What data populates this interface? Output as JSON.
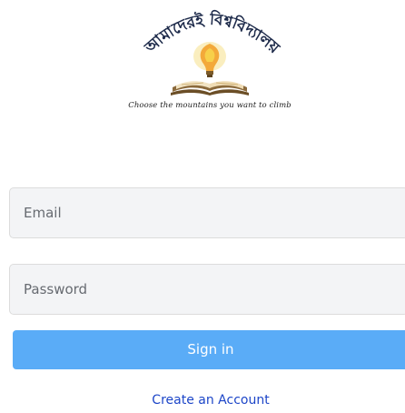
{
  "logo": {
    "wordmark": "আমাদেরই বিশ্ববিদ্যালয়",
    "tagline": "Choose the mountains you want to climb"
  },
  "form": {
    "email_placeholder": "Email",
    "password_placeholder": "Password",
    "signin_label": "Sign in",
    "create_account_label": "Create an Account"
  },
  "colors": {
    "primary_button": "#5aacf7",
    "link": "#1d46c8",
    "field_background": "#f3f4f6"
  }
}
